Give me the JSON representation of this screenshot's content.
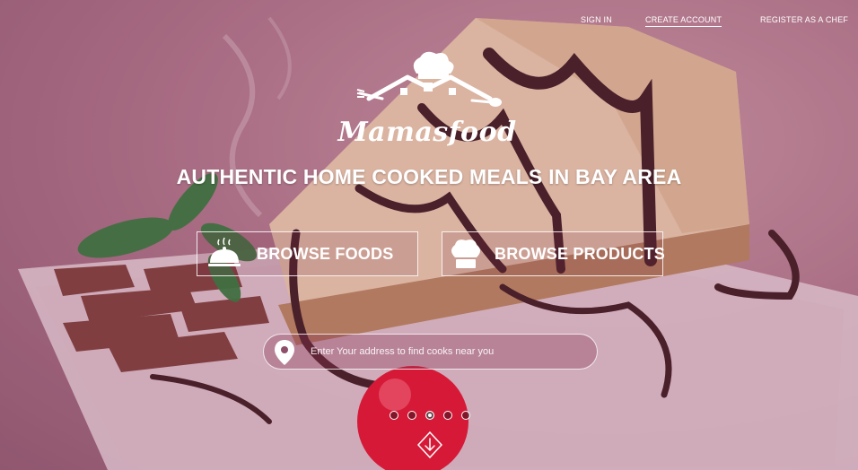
{
  "nav": {
    "sign_in": "SIGN IN",
    "create_account": "CREATE ACCOUNT",
    "register_chef": "REGISTER AS A CHEF"
  },
  "logo": {
    "wordmark": "Mamasfood",
    "icon": "house-chef-hat-logo"
  },
  "hero": {
    "headline": "AUTHENTIC HOME COOKED MEALS IN BAY AREA",
    "background": "cheesecake-with-chocolate-sauce-photo"
  },
  "cta": {
    "browse_foods": {
      "label": "BROWSE FOODS",
      "icon": "cloche-icon"
    },
    "browse_products": {
      "label": "BROWSE PRODUCTS",
      "icon": "chef-hat-icon"
    }
  },
  "search": {
    "placeholder": "Enter Your address to find cooks near you",
    "icon": "location-pin-icon"
  },
  "carousel": {
    "slide_count": 5,
    "active_slide": 3
  },
  "scroll_icon": "arrow-down-icon",
  "colors": {
    "overlay": "#a0587a",
    "text": "#ffffff"
  }
}
